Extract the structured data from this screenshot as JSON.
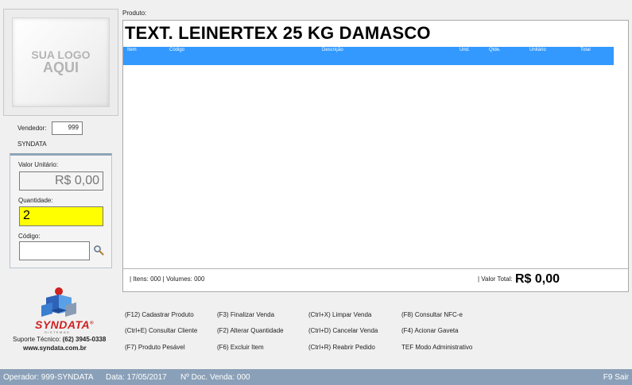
{
  "logo_placeholder": {
    "line1": "SUA LOGO",
    "line2": "AQUI"
  },
  "vendedor": {
    "label": "Vendedor:",
    "code": "999",
    "name": "SYNDATA"
  },
  "left_panel": {
    "valor_unitario_label": "Valor Unitário:",
    "valor_unitario": "R$ 0,00",
    "quantidade_label": "Quantidade:",
    "quantidade": "2",
    "codigo_label": "Código:",
    "codigo_value": "",
    "search_icon": "magnifier-icon"
  },
  "produto": {
    "label": "Produto:",
    "name": "TEXT. LEINERTEX 25 KG DAMASCO"
  },
  "grid": {
    "columns": [
      "Item",
      "Código",
      "Descrição",
      "Und.",
      "Qtde.",
      "Unitário",
      "Total"
    ]
  },
  "totals": {
    "items_info": "| Itens: 000 | Volumes: 000",
    "valor_total_label": "| Valor Total:",
    "valor_total": "R$ 0,00"
  },
  "brand": {
    "name": "SYNDATA",
    "reg": "®",
    "sub": "SISTEMAS",
    "suporte_label": "Suporte Técnico:",
    "suporte_phone": "(62) 3945-0338",
    "site": "www.syndata.com.br"
  },
  "shortcuts": [
    "(F12) Cadastrar Produto",
    "(F3) Finalizar Venda",
    "(Ctrl+X) Limpar Venda",
    "(F8) Consultar NFC-e",
    "(Ctrl+E) Consultar Cliente",
    "(F2) Alterar Quantidade",
    "(Ctrl+D) Cancelar Venda",
    "(F4) Acionar Gaveta",
    "(F7) Produto Pesável",
    "(F6) Excluir Item",
    "(Ctrl+R) Reabrir Pedido",
    "TEF Modo Administrativo"
  ],
  "status": {
    "operador": "Operador: 999-SYNDATA",
    "data": "Data: 17/05/2017",
    "doc": "Nº Doc. Venda: 000",
    "sair": "F9 Sair"
  },
  "colors": {
    "grid_header": "#3399ff",
    "quantity_bg": "#ffff00",
    "status_bar": "#8aa0b8",
    "brand_red": "#d02020"
  }
}
